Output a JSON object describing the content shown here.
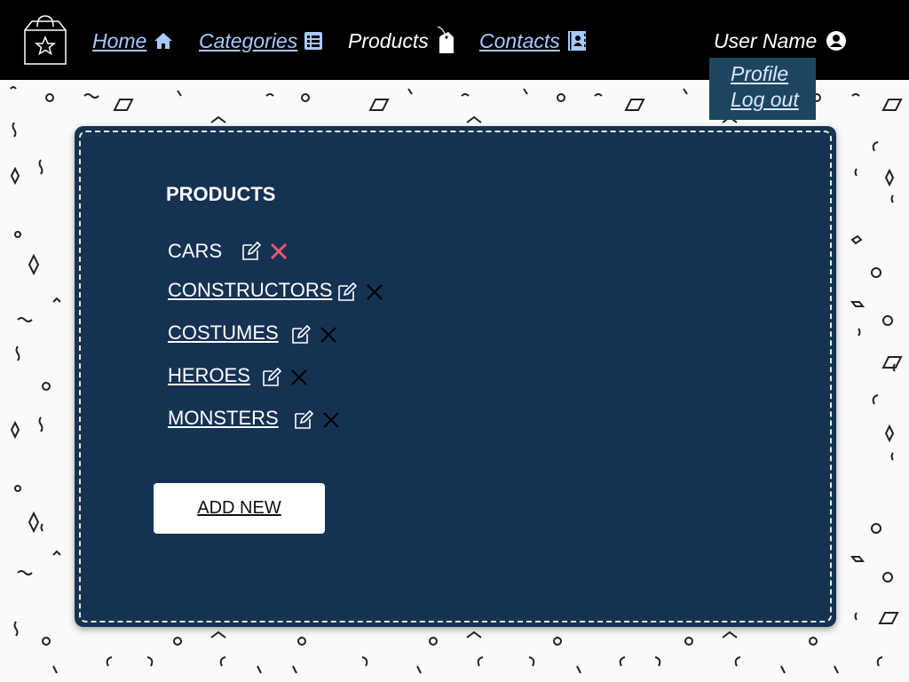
{
  "nav": {
    "home": "Home",
    "categories": "Categories",
    "products": "Products",
    "contacts": "Contacts",
    "user_name": "User Name"
  },
  "user_dropdown": {
    "items": [
      "Profile",
      "Log out"
    ]
  },
  "panel": {
    "title": "PRODUCTS",
    "items": [
      {
        "label": "CARS"
      },
      {
        "label": "CONSTRUCTORS"
      },
      {
        "label": "COSTUMES"
      },
      {
        "label": "HEROES"
      },
      {
        "label": "MONSTERS"
      }
    ],
    "add_button": "ADD NEW"
  },
  "colors": {
    "navbar": "#000000",
    "link": "#a8c8ff",
    "panel": "#163253",
    "dropdown": "#1d4560",
    "delete_active": "#e05a6b",
    "delete": "#000000"
  }
}
